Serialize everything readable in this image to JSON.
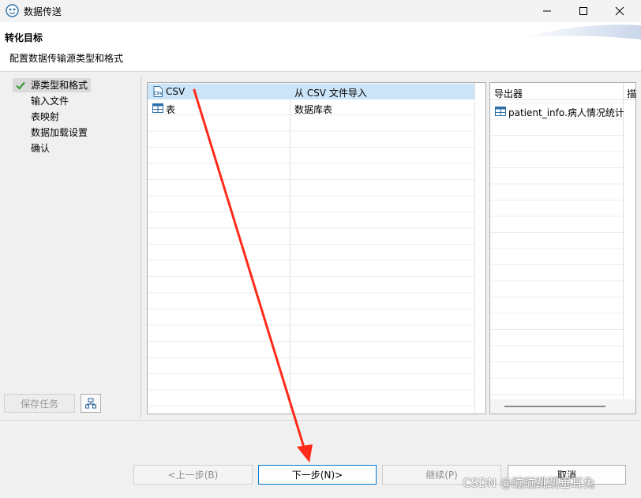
{
  "window": {
    "title": "数据传送",
    "minimize_icon": "minimize-icon",
    "maximize_icon": "maximize-icon",
    "close_icon": "close-icon"
  },
  "header": {
    "title": "转化目标",
    "subtitle": "配置数据传输源类型和格式"
  },
  "sidebar": {
    "steps": [
      {
        "label": "源类型和格式",
        "active": true
      },
      {
        "label": "输入文件",
        "active": false
      },
      {
        "label": "表映射",
        "active": false
      },
      {
        "label": "数据加载设置",
        "active": false
      },
      {
        "label": "确认",
        "active": false
      }
    ],
    "save_task_label": "保存任务",
    "schedule_icon": "schedule-icon"
  },
  "source_types": {
    "rows": [
      {
        "name": "CSV",
        "description": "从 CSV 文件导入",
        "icon": "csv-icon",
        "selected": true
      },
      {
        "name": "表",
        "description": "数据库表",
        "icon": "table-icon",
        "selected": false
      }
    ]
  },
  "exporters": {
    "col1": "导出器",
    "col2": "描",
    "rows": [
      {
        "name": "patient_info.病人情况统计",
        "icon": "table-icon"
      }
    ]
  },
  "footer": {
    "prev_label": "<上一步(B)",
    "next_label": "下一步(N)>",
    "continue_label": "继续(P)",
    "cancel_label": "取消"
  },
  "watermark": "CSDN @蹦蹦跳跳垂耳兔",
  "colors": {
    "accent": "#0078d4",
    "selection": "#cce4f7",
    "annotation_arrow": "#ff2a1a"
  }
}
